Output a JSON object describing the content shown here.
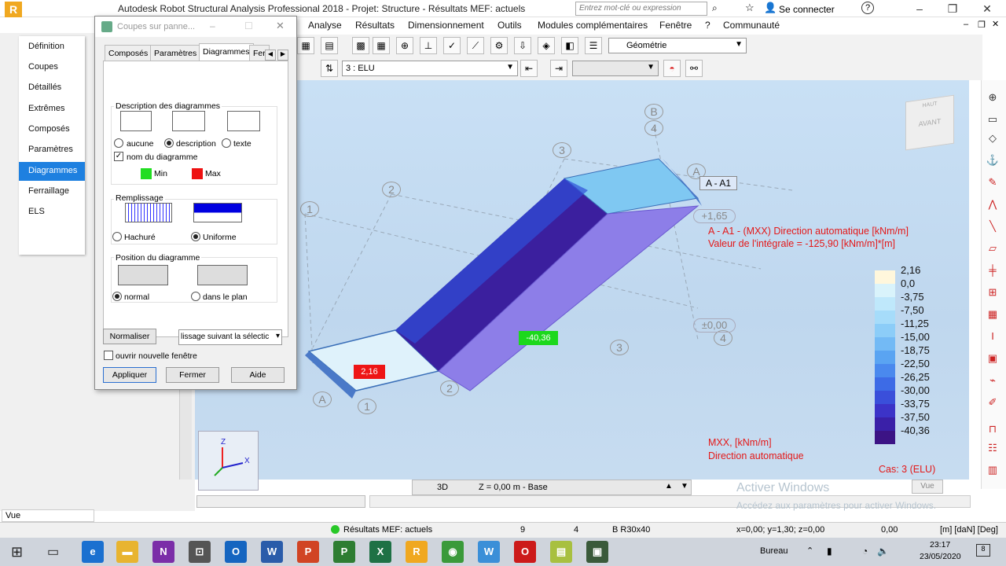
{
  "window": {
    "title": "Autodesk Robot Structural Analysis Professional 2018 - Projet: Structure - Résultats MEF: actuels",
    "search_placeholder": "Entrez mot-clé ou expression",
    "connect_label": "Se connecter",
    "help_label": "?"
  },
  "menubar": {
    "items": [
      "Analyse",
      "Résultats",
      "Dimensionnement",
      "Outils",
      "Modules complémentaires",
      "Fenêtre",
      "?",
      "Communauté"
    ]
  },
  "toolbar": {
    "view_combo": "Géométrie",
    "case_combo": "3 : ELU"
  },
  "sidemenu": {
    "items": [
      "Définition",
      "Coupes",
      "Détaillés",
      "Extrêmes",
      "Composés",
      "Paramètres",
      "Diagrammes",
      "Ferraillage",
      "ELS"
    ],
    "active_index": 6
  },
  "dialog": {
    "title": "Coupes sur panne...",
    "tabs": [
      "Composés",
      "Paramètres",
      "Diagrammes",
      "Fer"
    ],
    "active_tab": "Diagrammes",
    "description": {
      "label": "Description des diagrammes",
      "options": [
        "aucune",
        "description",
        "texte"
      ],
      "selected": "description",
      "name_checkbox_label": "nom du diagramme",
      "name_checked": true,
      "min_label": "Min",
      "max_label": "Max",
      "min_color": "#22dd22",
      "max_color": "#ee1111"
    },
    "fill": {
      "label": "Remplissage",
      "options": [
        "Hachuré",
        "Uniforme"
      ],
      "selected": "Uniforme"
    },
    "position": {
      "label": "Position du diagramme",
      "options": [
        "normal",
        "dans le plan"
      ],
      "selected": "normal"
    },
    "normalize_button": "Normaliser",
    "smoothing_select": "lissage suivant la sélectic",
    "new_window_label": "ouvrir nouvelle fenêtre",
    "new_window_checked": false,
    "apply_button": "Appliquer",
    "close_button": "Fermer",
    "help_button": "Aide"
  },
  "viewport": {
    "section_label": "A - A1",
    "result_title": "A - A1 - (MXX) Direction automatique [kNm/m]",
    "integral_text": "Valeur de l'intégrale = -125,90 [kNm/m]*[m]",
    "max_value_label": "2,16",
    "min_value_label": "-40,36",
    "level_label": "+1,65",
    "base_level_label": "±0,00",
    "grid_labels": [
      "B",
      "4",
      "3",
      "2",
      "1",
      "A",
      "3",
      "4",
      "2",
      "1",
      "A"
    ],
    "bottom_title": "MXX, [kNm/m]",
    "bottom_subtitle": "Direction automatique",
    "case_label": "Cas: 3 (ELU)",
    "viewcube_top": "HAUT",
    "viewcube_front": "AVANT",
    "axis_labels": {
      "z": "Z",
      "x": "X"
    },
    "watermark_title": "Activer Windows",
    "watermark_text": "Accédez aux paramètres pour activer Windows.",
    "vue_label": "Vue"
  },
  "legend": {
    "values": [
      "2,16",
      "0,0",
      "-3,75",
      "-7,50",
      "-11,25",
      "-15,00",
      "-18,75",
      "-22,50",
      "-26,25",
      "-30,00",
      "-33,75",
      "-37,50",
      "-40,36"
    ],
    "colors": [
      "#fff7dc",
      "#d9f3fb",
      "#bfe8fb",
      "#a6dcfa",
      "#8ccdf8",
      "#73baf5",
      "#5aa4f2",
      "#4a89ee",
      "#3d6be6",
      "#3a4fda",
      "#3c33c8",
      "#3a20a8",
      "#3c1385"
    ]
  },
  "viewbar": {
    "mode": "3D",
    "level": "Z = 0,00 m - Base"
  },
  "leftbottom": {
    "vue_label": "Vue"
  },
  "statusbar": {
    "results": "Résultats MEF: actuels",
    "num1": "9",
    "num2": "4",
    "section": "B R30x40",
    "coords": "x=0,00; y=1,30; z=0,00",
    "value": "0,00",
    "units": "[m] [daN] [Deg]"
  },
  "taskbar": {
    "location": "Bureau",
    "time": "23:17",
    "date": "23/05/2020"
  }
}
